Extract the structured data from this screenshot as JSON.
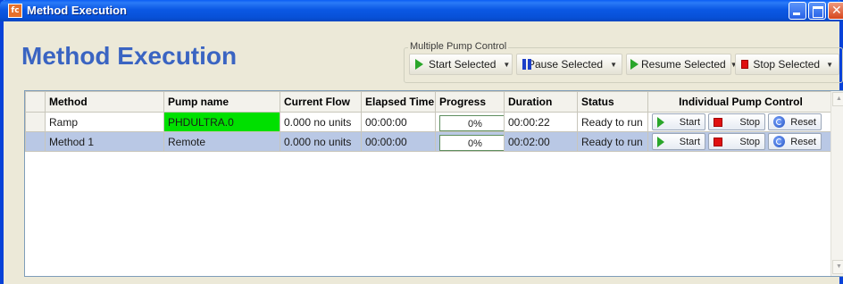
{
  "window": {
    "title": "Method Execution",
    "app_icon": "fc",
    "buttons": [
      "minimize",
      "maximize",
      "close"
    ]
  },
  "page": {
    "title": "Method Execution"
  },
  "pump_control": {
    "group_label": "Multiple Pump Control",
    "start_label": "Start Selected",
    "pause_label": "Pause Selected",
    "resume_label": "Resume Selected",
    "stop_label": "Stop Selected"
  },
  "table": {
    "columns": [
      "Method",
      "Pump name",
      "Current Flow",
      "Elapsed Time",
      "Progress",
      "Duration",
      "Status",
      "Individual Pump Control"
    ],
    "rows": [
      {
        "method": "Ramp",
        "pump": "PHDULTRA.0",
        "flow": "0.000 no units",
        "elapsed": "00:00:00",
        "progress": "0%",
        "duration": "00:00:22",
        "status": "Ready to run",
        "selected": false
      },
      {
        "method": "Method 1",
        "pump": "Remote",
        "flow": "0.000 no units",
        "elapsed": "00:00:00",
        "progress": "0%",
        "duration": "00:02:00",
        "status": "Ready to run",
        "selected": true
      }
    ],
    "row_buttons": {
      "start": "Start",
      "stop": "Stop",
      "reset": "Reset"
    }
  },
  "colors": {
    "title_blue": "#3a64c2",
    "selected_row": "#b9c8e5",
    "pump_highlight": "#00e000"
  }
}
